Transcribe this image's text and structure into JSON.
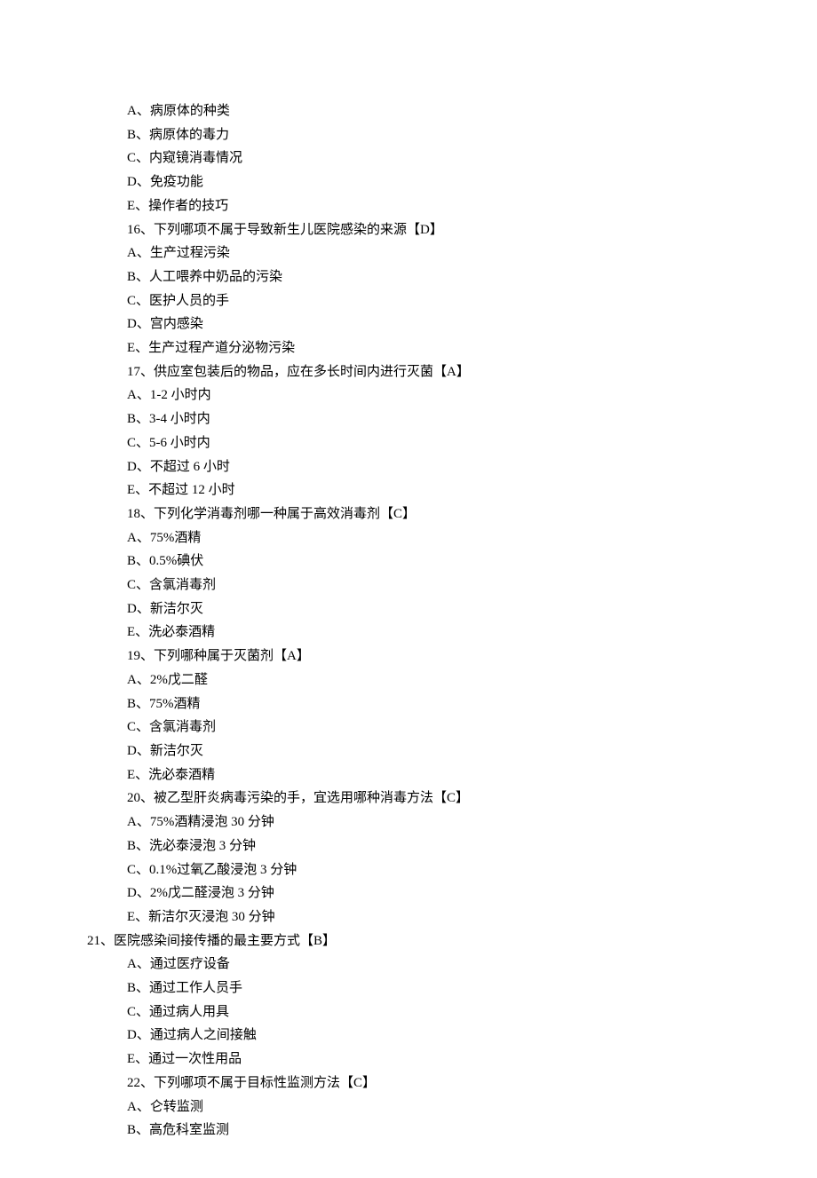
{
  "lines": [
    {
      "indent": 1,
      "text": "A、病原体的种类"
    },
    {
      "indent": 1,
      "text": "B、病原体的毒力"
    },
    {
      "indent": 1,
      "text": "C、内窥镜消毒情况"
    },
    {
      "indent": 1,
      "text": "D、免疫功能"
    },
    {
      "indent": 1,
      "text": "E、操作者的技巧"
    },
    {
      "indent": 1,
      "text": "16、下列哪项不属于导致新生儿医院感染的来源【D】"
    },
    {
      "indent": 1,
      "text": "A、生产过程污染"
    },
    {
      "indent": 1,
      "text": "B、人工喂养中奶品的污染"
    },
    {
      "indent": 1,
      "text": "C、医护人员的手"
    },
    {
      "indent": 1,
      "text": "D、宫内感染"
    },
    {
      "indent": 1,
      "text": "E、生产过程产道分泌物污染"
    },
    {
      "indent": 1,
      "text": "17、供应室包装后的物品，应在多长时间内进行灭菌【A】"
    },
    {
      "indent": 1,
      "text": "A、1-2 小时内"
    },
    {
      "indent": 1,
      "text": "B、3-4 小时内"
    },
    {
      "indent": 1,
      "text": "C、5-6 小时内"
    },
    {
      "indent": 1,
      "text": "D、不超过 6 小时"
    },
    {
      "indent": 1,
      "text": "E、不超过 12 小时"
    },
    {
      "indent": 1,
      "text": "18、下列化学消毒剂哪一种属于高效消毒剂【C】"
    },
    {
      "indent": 1,
      "text": "A、75%酒精"
    },
    {
      "indent": 1,
      "text": "B、0.5%碘伏"
    },
    {
      "indent": 1,
      "text": "C、含氯消毒剂"
    },
    {
      "indent": 1,
      "text": "D、新洁尔灭"
    },
    {
      "indent": 1,
      "text": "E、洗必泰酒精"
    },
    {
      "indent": 1,
      "text": "19、下列哪种属于灭菌剂【A】"
    },
    {
      "indent": 1,
      "text": "A、2%戊二醛"
    },
    {
      "indent": 1,
      "text": "B、75%酒精"
    },
    {
      "indent": 1,
      "text": "C、含氯消毒剂"
    },
    {
      "indent": 1,
      "text": "D、新洁尔灭"
    },
    {
      "indent": 1,
      "text": "E、洗必泰酒精"
    },
    {
      "indent": 1,
      "text": "20、被乙型肝炎病毒污染的手，宜选用哪种消毒方法【C】"
    },
    {
      "indent": 1,
      "text": "A、75%酒精浸泡 30 分钟"
    },
    {
      "indent": 1,
      "text": "B、洗必泰浸泡 3 分钟"
    },
    {
      "indent": 1,
      "text": "C、0.1%过氧乙酸浸泡 3 分钟"
    },
    {
      "indent": 1,
      "text": "D、2%戊二醛浸泡 3 分钟"
    },
    {
      "indent": 1,
      "text": "E、新洁尔灭浸泡 30 分钟"
    },
    {
      "indent": 0,
      "text": "21、医院感染间接传播的最主要方式【B】"
    },
    {
      "indent": 1,
      "text": "A、通过医疗设备"
    },
    {
      "indent": 1,
      "text": "B、通过工作人员手"
    },
    {
      "indent": 1,
      "text": "C、通过病人用具"
    },
    {
      "indent": 1,
      "text": "D、通过病人之间接触"
    },
    {
      "indent": 1,
      "text": "E、通过一次性用品"
    },
    {
      "indent": 1,
      "text": "22、下列哪项不属于目标性监测方法【C】"
    },
    {
      "indent": 1,
      "text": "A、仑转监测"
    },
    {
      "indent": 1,
      "text": "B、高危科室监测"
    }
  ]
}
